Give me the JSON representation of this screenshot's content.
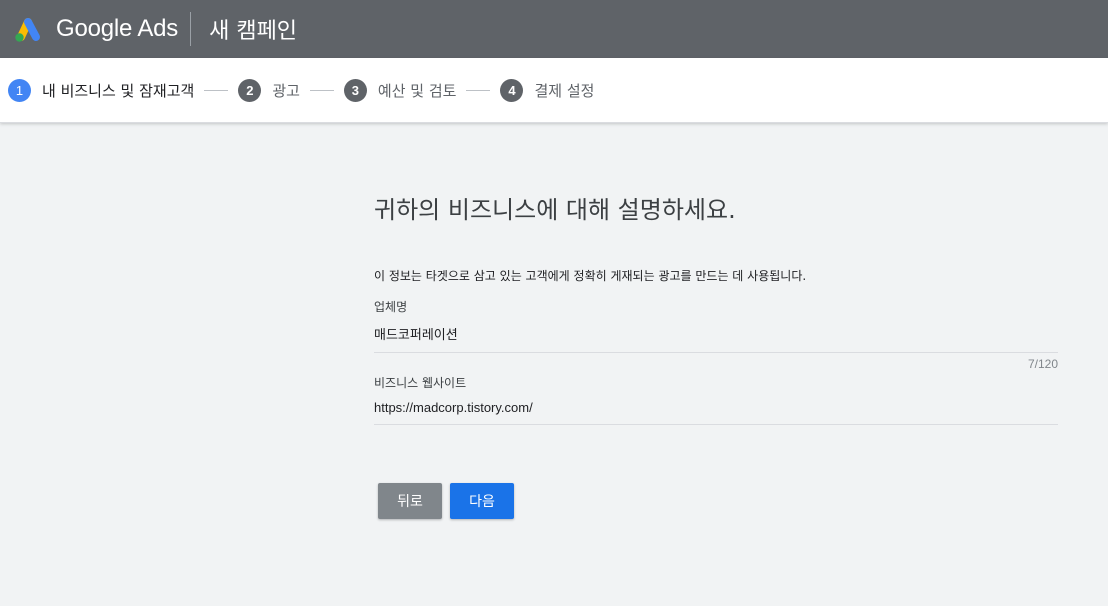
{
  "header": {
    "brand": "Google Ads",
    "campaign_title": "새 캠페인",
    "logo_icon": "google-ads-logo-icon",
    "colors": {
      "bar": "#5f6368",
      "logo_blue": "#4285f4",
      "logo_yellow": "#fbbc04",
      "logo_green": "#34a853"
    }
  },
  "stepper": {
    "steps": [
      {
        "number": "1",
        "label": "내 비즈니스 및 잠재고객",
        "active": true
      },
      {
        "number": "2",
        "label": "광고",
        "active": false
      },
      {
        "number": "3",
        "label": "예산 및 검토",
        "active": false
      },
      {
        "number": "4",
        "label": "결제 설정",
        "active": false
      }
    ],
    "active_color": "#4285f4"
  },
  "form": {
    "heading": "귀하의 비즈니스에 대해 설명하세요.",
    "description": "이 정보는 타겟으로 삼고 있는 고객에게 정확히 게재되는 광고를 만드는 데 사용됩니다.",
    "business_name": {
      "label": "업체명",
      "value": "매드코퍼레이션",
      "counter": "7/120"
    },
    "website": {
      "label": "비즈니스 웹사이트",
      "value": "https://madcorp.tistory.com/"
    }
  },
  "actions": {
    "back_label": "뒤로",
    "next_label": "다음",
    "next_color": "#1a73e8"
  }
}
